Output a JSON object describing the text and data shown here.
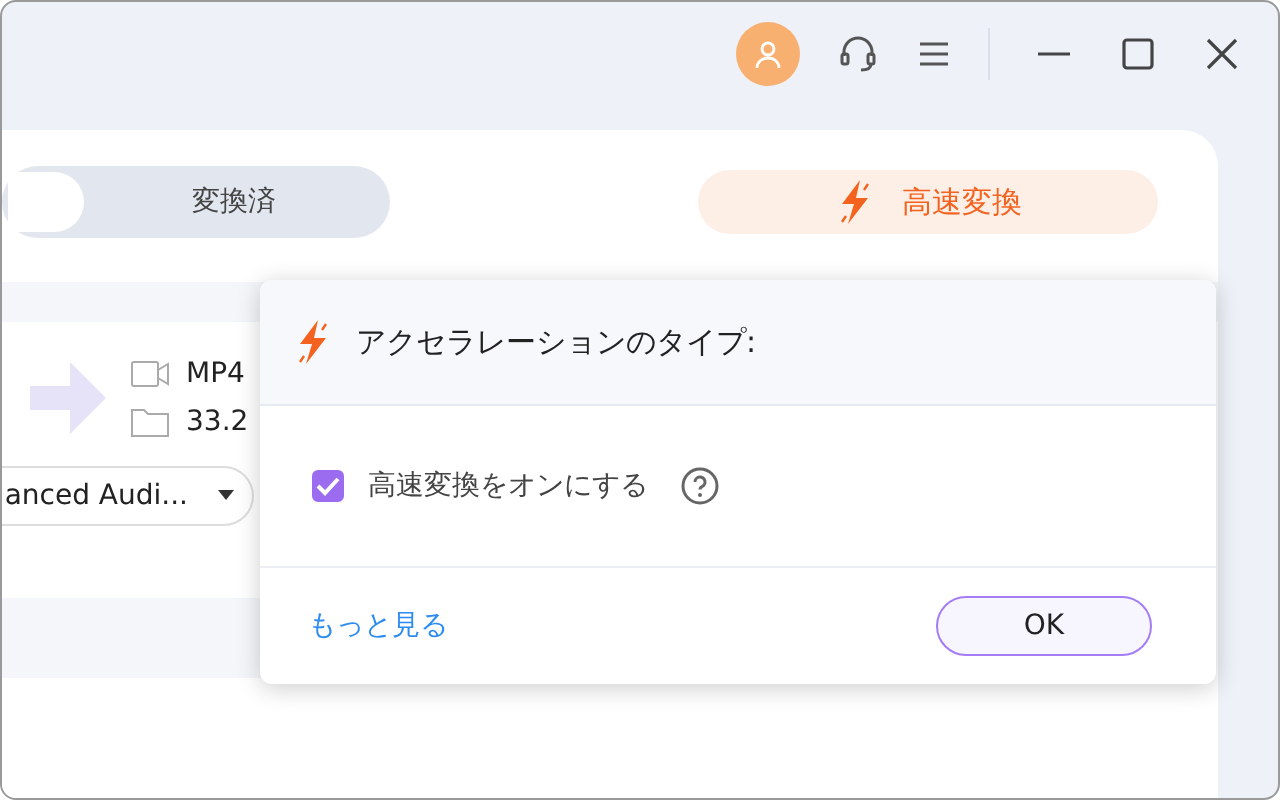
{
  "tabs": [
    {
      "selected": true
    },
    {
      "label": "変換済",
      "selected": false
    }
  ],
  "turbo_button": {
    "label": "高速変換"
  },
  "file": {
    "format": "MP4",
    "size": "33.2"
  },
  "audio_dropdown": {
    "value": "anced Audi..."
  },
  "dialog": {
    "title": "アクセラレーションのタイプ:",
    "option": {
      "label": "高速変換をオンにする",
      "checked": true
    },
    "link": "もっと見る",
    "ok": "OK"
  }
}
